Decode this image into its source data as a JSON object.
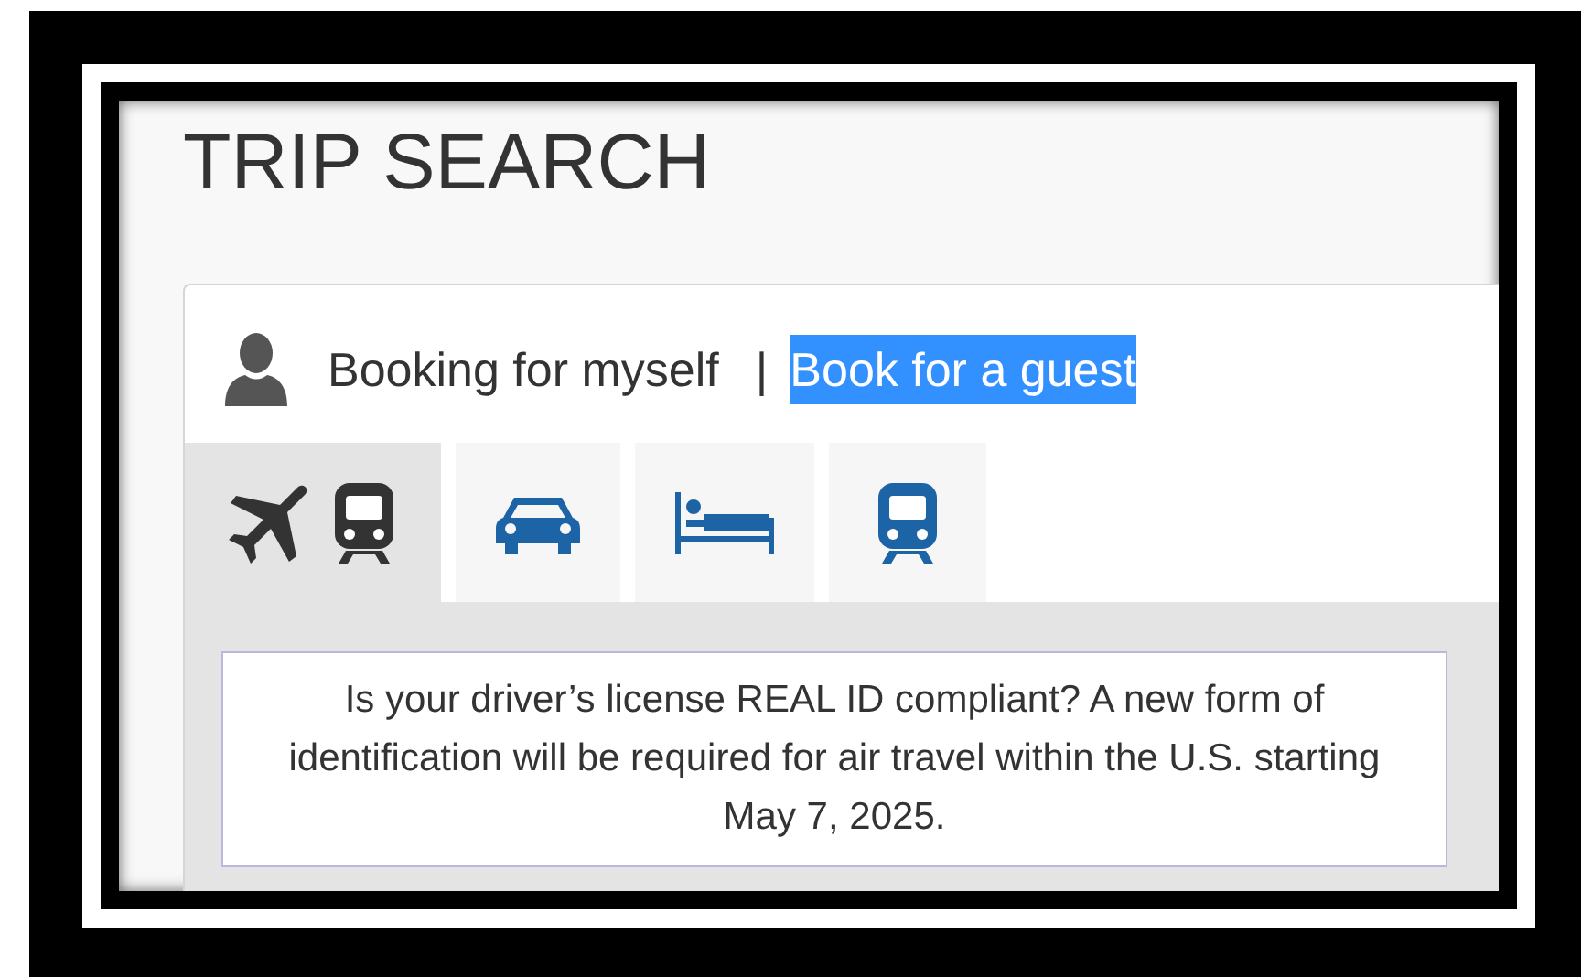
{
  "title": "TRIP SEARCH",
  "booking": {
    "options": [
      {
        "label": "Booking for myself",
        "highlighted": false
      },
      {
        "label": "Book for a guest",
        "highlighted": true
      }
    ],
    "separator": "|"
  },
  "tabs": [
    {
      "kind": "flight-rail",
      "selected": true
    },
    {
      "kind": "car",
      "selected": false
    },
    {
      "kind": "hotel",
      "selected": false
    },
    {
      "kind": "rail",
      "selected": false
    }
  ],
  "notice": "Is your driver’s license REAL ID compliant? A new form of identification will be required for air travel within the U.S. starting May 7, 2025."
}
